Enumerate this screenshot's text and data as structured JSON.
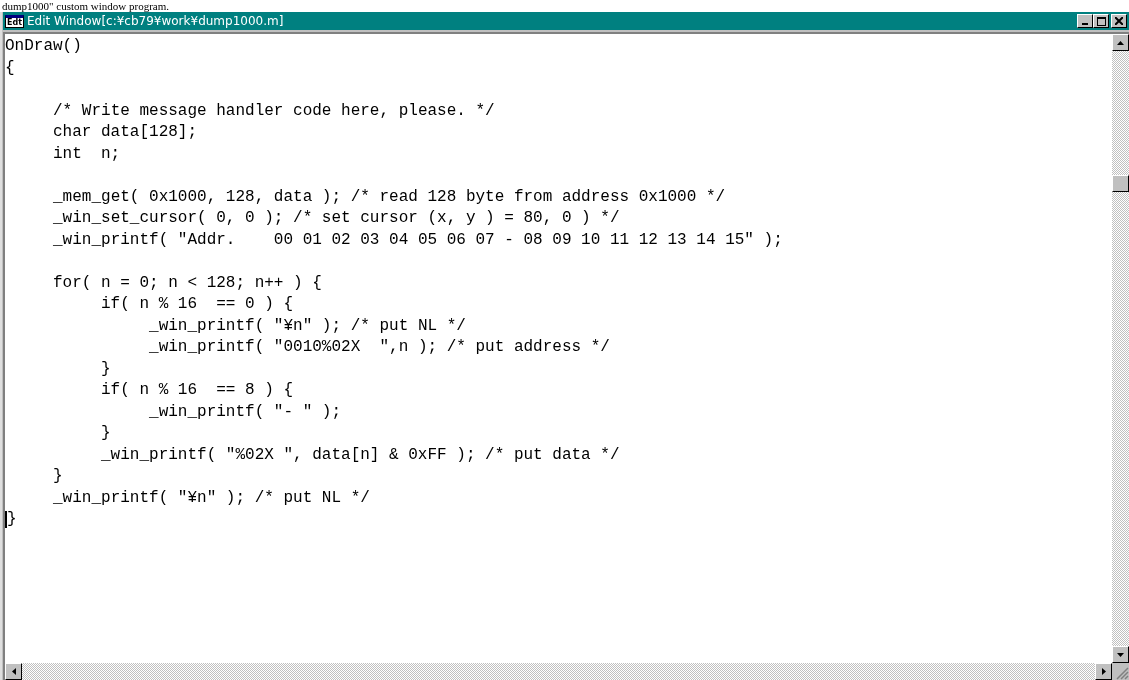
{
  "caption": "dump1000\" custom window program.",
  "window": {
    "title": "Edit Window[c:¥cb79¥work¥dump1000.m]",
    "app_icon_text": "Edt"
  },
  "editor": {
    "blocks": [
      [
        "OnDraw()",
        "{"
      ],
      [
        "\t/* Write message handler code here, please. */",
        "\tchar\tdata[128];",
        "\tint\tn;"
      ],
      [
        "\t_mem_get( 0x1000, 128, data ); /* read 128 byte from address 0x1000 */",
        "\t_win_set_cursor( 0, 0 ); /* set cursor (x, y ) = 80, 0 ) */",
        "\t_win_printf( \"Addr.    00 01 02 03 04 05 06 07 - 08 09 10 11 12 13 14 15\" );"
      ],
      [
        "\tfor( n = 0; n < 128; n++ ) {",
        "\t\tif( n % 16  == 0 ) {",
        "\t\t\t_win_printf( \"¥n\" ); /* put NL */",
        "\t\t\t_win_printf( \"0010%02X  \",n ); /* put address */",
        "\t\t}",
        "\t\tif( n % 16  == 8 ) {",
        "\t\t\t_win_printf( \"- \" );",
        "\t\t}",
        "\t\t_win_printf( \"%02X \", data[n] & 0xFF ); /* put data */",
        "\t}",
        "\t_win_printf( \"¥n\" ); /* put NL */",
        "}"
      ]
    ]
  }
}
